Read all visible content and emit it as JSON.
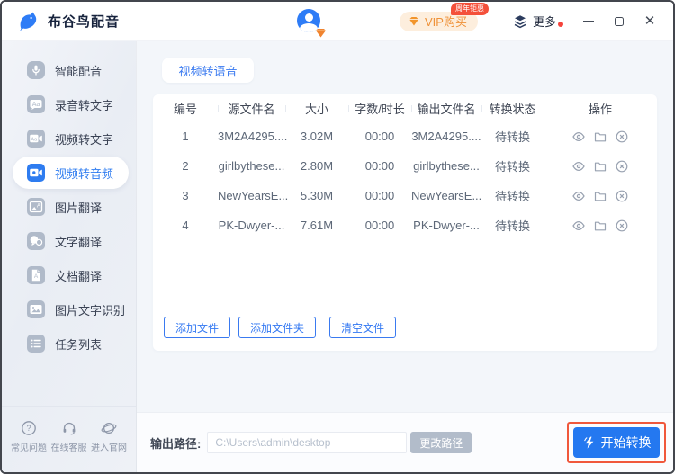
{
  "titlebar": {
    "app_title": "布谷鸟配音",
    "vip_button": "VIP购买",
    "vip_badge": "周年钜惠",
    "more_label": "更多"
  },
  "sidebar": {
    "items": [
      {
        "label": "智能配音",
        "selected": false
      },
      {
        "label": "录音转文字",
        "selected": false
      },
      {
        "label": "视频转文字",
        "selected": false
      },
      {
        "label": "视频转音频",
        "selected": true
      },
      {
        "label": "图片翻译",
        "selected": false
      },
      {
        "label": "文字翻译",
        "selected": false
      },
      {
        "label": "文档翻译",
        "selected": false
      },
      {
        "label": "图片文字识别",
        "selected": false
      },
      {
        "label": "任务列表",
        "selected": false
      }
    ],
    "footer": [
      {
        "label": "常见问题"
      },
      {
        "label": "在线客服"
      },
      {
        "label": "进入官网"
      }
    ]
  },
  "main": {
    "tab_label": "视频转语音",
    "table": {
      "headers": [
        "编号",
        "源文件名",
        "大小",
        "字数/时长",
        "输出文件名",
        "转换状态",
        "操作"
      ],
      "rows": [
        {
          "no": "1",
          "source": "3M2A4295....",
          "size": "3.02M",
          "duration": "00:00",
          "output": "3M2A4295....",
          "status": "待转换"
        },
        {
          "no": "2",
          "source": "girlbythese...",
          "size": "2.80M",
          "duration": "00:00",
          "output": "girlbythese...",
          "status": "待转换"
        },
        {
          "no": "3",
          "source": "NewYearsE...",
          "size": "5.30M",
          "duration": "00:00",
          "output": "NewYearsE...",
          "status": "待转换"
        },
        {
          "no": "4",
          "source": "PK-Dwyer-...",
          "size": "7.61M",
          "duration": "00:00",
          "output": "PK-Dwyer-...",
          "status": "待转换"
        }
      ]
    },
    "file_buttons": [
      "添加文件",
      "添加文件夹",
      "清空文件"
    ],
    "output_path_label": "输出路径:",
    "output_path_value": "C:\\Users\\admin\\desktop",
    "change_path_label": "更改路径",
    "start_label": "开始转换"
  },
  "colors": {
    "primary_blue": "#2e7cf0",
    "accent_orange": "#ef9239",
    "badge_red": "#f4503a",
    "annotation_red": "#f0583c"
  }
}
